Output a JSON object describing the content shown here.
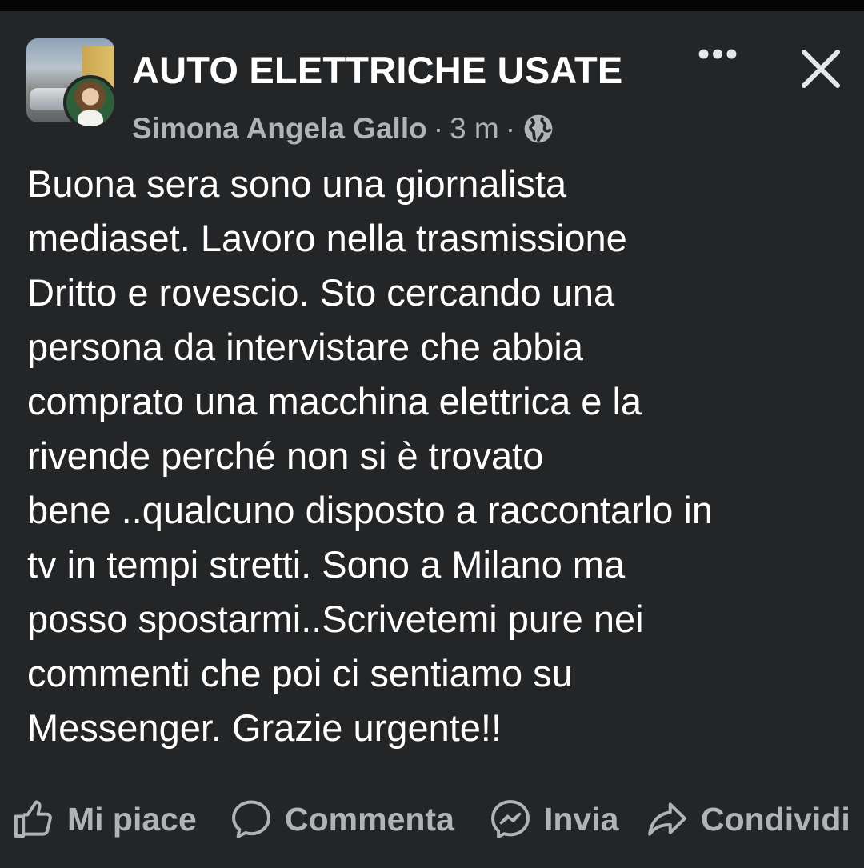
{
  "post": {
    "group_name": "AUTO ELETTRICHE USATE",
    "author": "Simona Angela Gallo",
    "separator": "·",
    "time": "3 m",
    "privacy_icon": "globe-icon",
    "more_label": "•••",
    "close_icon": "close-icon",
    "text_lines": [
      "Buona sera sono una giornalista",
      "mediaset. Lavoro nella trasmissione",
      "Dritto e rovescio. Sto cercando una",
      "persona da intervistare che abbia",
      "comprato una macchina elettrica e la",
      "rivende perché non si è trovato",
      "bene ..qualcuno disposto a raccontarlo in",
      "tv in tempi stretti. Sono a Milano ma",
      "posso spostarmi..Scrivetemi pure nei",
      "commenti che poi ci sentiamo su",
      "Messenger. Grazie urgente!!"
    ]
  },
  "actions": {
    "like": {
      "label": "Mi piace",
      "icon": "thumbs-up-icon"
    },
    "comment": {
      "label": "Commenta",
      "icon": "comment-bubble-icon"
    },
    "send": {
      "label": "Invia",
      "icon": "messenger-icon"
    },
    "share": {
      "label": "Condividi",
      "icon": "share-arrow-icon"
    }
  },
  "colors": {
    "background": "#242527",
    "primary_text": "#ffffff",
    "secondary_text": "#b0b3b8"
  }
}
